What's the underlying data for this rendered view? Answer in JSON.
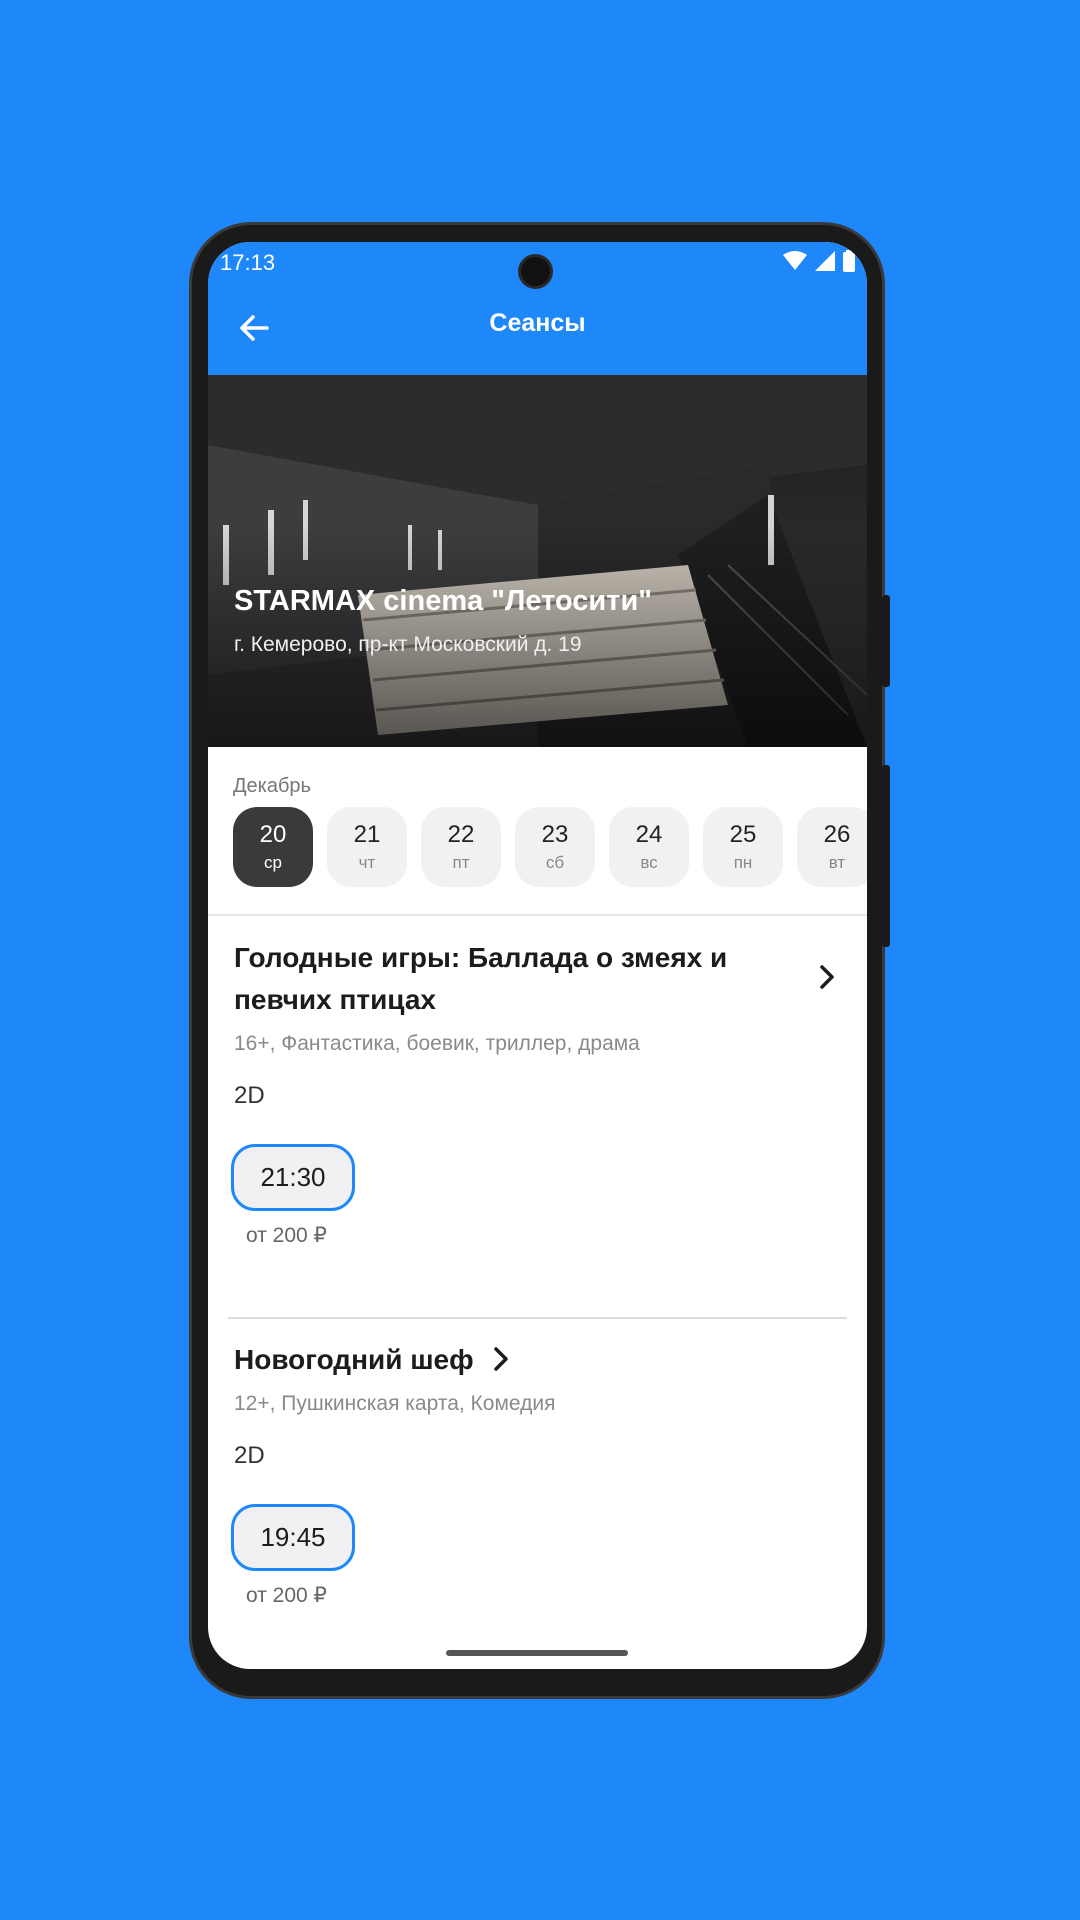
{
  "status_bar": {
    "time": "17:13"
  },
  "header": {
    "title": "Сеансы"
  },
  "cinema": {
    "name": "STARMAX cinema \"Летосити\"",
    "address": "г. Кемерово, пр-кт Московский д. 19"
  },
  "calendar": {
    "month": "Декабрь",
    "days": [
      {
        "day": "20",
        "weekday": "ср",
        "selected": true
      },
      {
        "day": "21",
        "weekday": "чт",
        "selected": false
      },
      {
        "day": "22",
        "weekday": "пт",
        "selected": false
      },
      {
        "day": "23",
        "weekday": "сб",
        "selected": false
      },
      {
        "day": "24",
        "weekday": "вс",
        "selected": false
      },
      {
        "day": "25",
        "weekday": "пн",
        "selected": false
      },
      {
        "day": "26",
        "weekday": "вт",
        "selected": false
      }
    ]
  },
  "movies": [
    {
      "title": "Голодные игры: Баллада о змеях и певчих птицах",
      "meta": "16+, Фантастика, боевик, триллер, драма",
      "format": "2D",
      "sessions": [
        {
          "time": "21:30",
          "price": "от 200 ₽"
        }
      ]
    },
    {
      "title": "Новогодний шеф",
      "meta": "12+, Пушкинская карта, Комедия",
      "format": "2D",
      "sessions": [
        {
          "time": "19:45",
          "price": "от 200 ₽"
        }
      ]
    }
  ],
  "colors": {
    "accent": "#1e88fb",
    "selected_date": "#3a3a3c"
  }
}
